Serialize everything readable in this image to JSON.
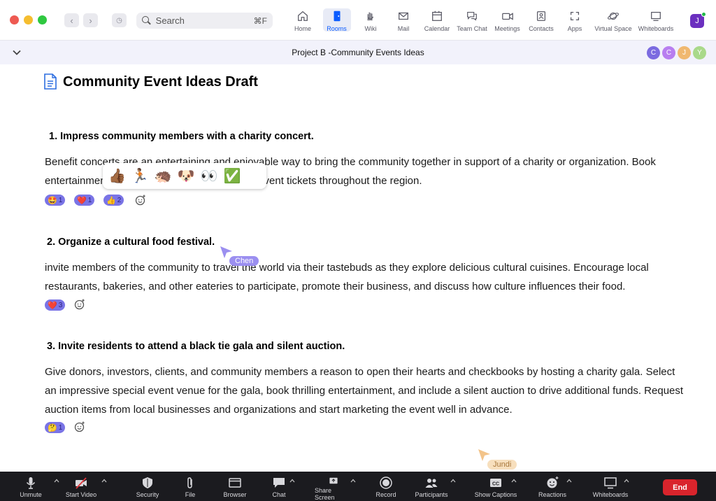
{
  "topbar": {
    "search_placeholder": "Search",
    "search_shortcut": "⌘F",
    "tabs": [
      {
        "label": "Home",
        "icon": "home-icon"
      },
      {
        "label": "Rooms",
        "icon": "door-icon"
      },
      {
        "label": "Wiki",
        "icon": "wiki-icon"
      },
      {
        "label": "Mail",
        "icon": "mail-icon"
      },
      {
        "label": "Calendar",
        "icon": "calendar-icon"
      },
      {
        "label": "Team Chat",
        "icon": "chat-bubbles-icon"
      },
      {
        "label": "Meetings",
        "icon": "video-camera-icon"
      },
      {
        "label": "Contacts",
        "icon": "contacts-icon"
      },
      {
        "label": "Apps",
        "icon": "apps-icon"
      },
      {
        "label": "Virtual Space",
        "icon": "planet-icon"
      },
      {
        "label": "Whiteboards",
        "icon": "whiteboard-icon"
      }
    ],
    "active_tab": "Rooms",
    "user_initial": "J"
  },
  "docbar": {
    "title": "Project B -Community Events Ideas",
    "collaborators": [
      {
        "initial": "C",
        "color": "#7b6be0"
      },
      {
        "initial": "C",
        "color": "#b87ef0"
      },
      {
        "initial": "J",
        "color": "#f0b870"
      },
      {
        "initial": "Y",
        "color": "#a9d98a"
      }
    ]
  },
  "document": {
    "title": "Community Event Ideas Draft",
    "sections": [
      {
        "heading": "1.  Impress community members with a charity concert.",
        "body": "Benefit concerts are an entertaining and enjoyable way to bring the community together in support of a charity or organization. Book entertainment, secure a venue, and advertise event tickets throughout the region.",
        "reactions": [
          {
            "emoji": "🤩",
            "count": "1"
          },
          {
            "emoji": "❤️",
            "count": "1"
          },
          {
            "emoji": "👍",
            "count": "2"
          }
        ]
      },
      {
        "heading": "2. Organize a cultural food festival.",
        "body": "invite members of the community to travel the world via their tastebuds as they explore delicious cultural cuisines. Encourage local restaurants, bakeries, and other eateries to participate, promote their business, and discuss how culture influences their food.",
        "reactions": [
          {
            "emoji": "❤️",
            "count": "3"
          }
        ]
      },
      {
        "heading": "3. Invite residents to attend a black tie gala and silent auction.",
        "body": "Give donors, investors, clients, and community members a reason to open their hearts and checkbooks by hosting a charity gala. Select an impressive special event venue for the gala, book thrilling entertainment, and include a silent auction to drive additional funds. Request auction items from local businesses and organizations and start marketing the event well in advance.",
        "reactions": [
          {
            "emoji": "🤔",
            "count": "1"
          }
        ]
      }
    ],
    "emoji_picker": [
      "👍🏾",
      "🏃🏽",
      "🦔",
      "🐶",
      "👀",
      "✅"
    ],
    "cursors": [
      {
        "name": "Chen",
        "color": "#9b8ff0"
      },
      {
        "name": "Jundi",
        "color": "#f3c48a"
      }
    ]
  },
  "bottombar": {
    "buttons": [
      {
        "label": "Unmute",
        "icon": "microphone-icon"
      },
      {
        "label": "Start Video",
        "icon": "video-off-icon"
      },
      {
        "label": "Security",
        "icon": "shield-icon"
      },
      {
        "label": "File",
        "icon": "paperclip-icon"
      },
      {
        "label": "Browser",
        "icon": "browser-icon"
      },
      {
        "label": "Chat",
        "icon": "chat-icon"
      },
      {
        "label": "Share Screen",
        "icon": "share-screen-icon"
      },
      {
        "label": "Record",
        "icon": "record-icon"
      },
      {
        "label": "Participants",
        "icon": "participants-icon"
      },
      {
        "label": "Show Captions",
        "icon": "captions-icon"
      },
      {
        "label": "Reactions",
        "icon": "smiley-icon"
      },
      {
        "label": "Whiteboards",
        "icon": "whiteboard-icon"
      }
    ],
    "end_label": "End",
    "end_color": "#d9242c"
  }
}
